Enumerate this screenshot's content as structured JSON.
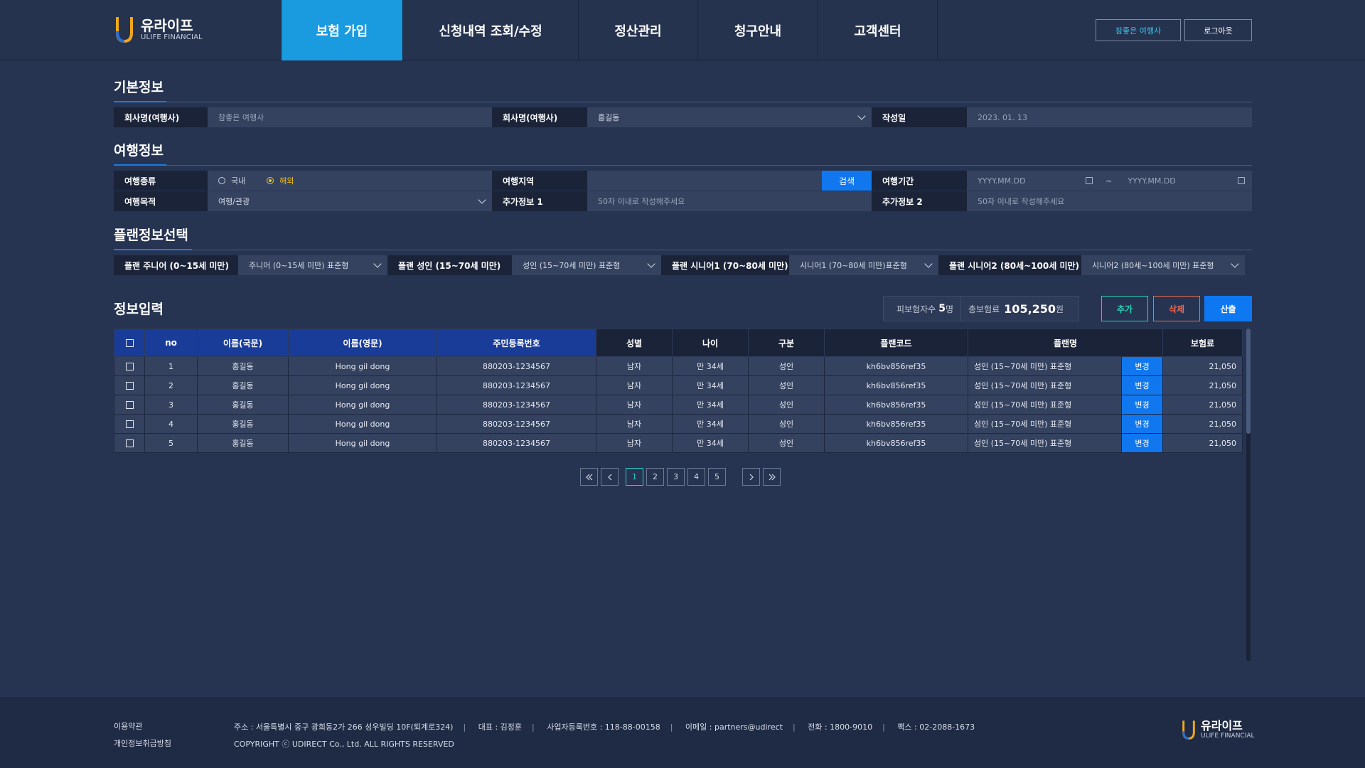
{
  "header": {
    "logo_ko": "유라이프",
    "logo_en": "ULIFE FINANCIAL",
    "nav": [
      "보험 가입",
      "신청내역 조회/수정",
      "정산관리",
      "청구안내",
      "고객센터"
    ],
    "company_button": "참좋은 여행사",
    "logout_button": "로그아웃"
  },
  "basic": {
    "title": "기본정보",
    "company_label": "회사명(여행사)",
    "company_value": "참좋은 여행사",
    "manager_label": "회사명(여행사)",
    "manager_value": "홍길동",
    "date_label": "작성일",
    "date_value": "2023. 01. 13"
  },
  "travel": {
    "title": "여행정보",
    "type_label": "여행종류",
    "type_domestic": "국내",
    "type_overseas": "해외",
    "region_label": "여행지역",
    "search_button": "검색",
    "period_label": "여행기간",
    "period_start": "YYYY.MM.DD",
    "period_tilde": "~",
    "period_end": "YYYY.MM.DD",
    "purpose_label": "여행목적",
    "purpose_value": "여행/관광",
    "extra1_label": "추가정보 1",
    "extra1_placeholder": "50자 이내로 작성해주세요",
    "extra2_label": "추가정보 2",
    "extra2_placeholder": "50자 이내로 작성해주세요"
  },
  "plan": {
    "title": "플랜정보선택",
    "junior_label": "플랜 주니어 (0~15세 미만)",
    "junior_value": "주니어 (0~15세 미만) 표준형",
    "adult_label": "플랜 성인 (15~70세 미만)",
    "adult_value": "성인 (15~70세 미만) 표준형",
    "senior1_label": "플랜 시니어1 (70~80세 미만)",
    "senior1_value": "시니어1 (70~80세 미만)표준형",
    "senior2_label": "플랜 시니어2 (80세~100세 미만)",
    "senior2_value": "시니어2 (80세~100세 미만) 표준형"
  },
  "input": {
    "title": "정보입력",
    "insured_label": "피보험자수",
    "insured_count": "5",
    "insured_unit": "명",
    "premium_label": "총보험료",
    "premium_value": "105,250",
    "premium_unit": "원",
    "add_button": "추가",
    "delete_button": "삭제",
    "calc_button": "산출"
  },
  "table": {
    "columns": [
      "no",
      "이름(국문)",
      "이름(영문)",
      "주민등록번호",
      "성별",
      "나이",
      "구분",
      "플랜코드",
      "플랜명",
      "보험료"
    ],
    "change_label": "변경",
    "rows": [
      {
        "no": "1",
        "name_ko": "홍길동",
        "name_en": "Hong gil dong",
        "rrn": "880203-1234567",
        "gender": "남자",
        "age": "만 34세",
        "type": "성인",
        "plan_code": "kh6bv856ref35",
        "plan_name": "성인 (15~70세 미만) 표준형",
        "premium": "21,050"
      },
      {
        "no": "2",
        "name_ko": "홍길동",
        "name_en": "Hong gil dong",
        "rrn": "880203-1234567",
        "gender": "남자",
        "age": "만 34세",
        "type": "성인",
        "plan_code": "kh6bv856ref35",
        "plan_name": "성인 (15~70세 미만) 표준형",
        "premium": "21,050"
      },
      {
        "no": "3",
        "name_ko": "홍길동",
        "name_en": "Hong gil dong",
        "rrn": "880203-1234567",
        "gender": "남자",
        "age": "만 34세",
        "type": "성인",
        "plan_code": "kh6bv856ref35",
        "plan_name": "성인 (15~70세 미만) 표준형",
        "premium": "21,050"
      },
      {
        "no": "4",
        "name_ko": "홍길동",
        "name_en": "Hong gil dong",
        "rrn": "880203-1234567",
        "gender": "남자",
        "age": "만 34세",
        "type": "성인",
        "plan_code": "kh6bv856ref35",
        "plan_name": "성인 (15~70세 미만) 표준형",
        "premium": "21,050"
      },
      {
        "no": "5",
        "name_ko": "홍길동",
        "name_en": "Hong gil dong",
        "rrn": "880203-1234567",
        "gender": "남자",
        "age": "만 34세",
        "type": "성인",
        "plan_code": "kh6bv856ref35",
        "plan_name": "성인 (15~70세 미만) 표준형",
        "premium": "21,050"
      }
    ]
  },
  "pagination": {
    "pages": [
      "1",
      "2",
      "3",
      "4",
      "5"
    ],
    "current": "1"
  },
  "footer": {
    "terms": "이용약관",
    "privacy": "개인정보취급방침",
    "address": "주소 : 서울특별시 중구 광희동2가 266 성우빌딩 10F(퇴계로324)",
    "ceo": "대표 : 김정훈",
    "biz_no": "사업자등록번호 : 118-88-00158",
    "email": "이메일 : partners@udirect",
    "phone": "전화 : 1800-9010",
    "fax": "팩스 : 02-2088-1673",
    "copyright": "COPYRIGHT ⓒ UDIRECT Co., Ltd. ALL RIGHTS RESERVED",
    "logo_ko": "유라이프",
    "logo_en": "ULIFE FINANCIAL"
  },
  "colors": {
    "bg": "#263452",
    "accent": "#1a9be0",
    "button_blue": "#1177ee",
    "add": "#2ad1b4",
    "delete": "#f06a4e",
    "radio_on": "#f1c21b"
  }
}
